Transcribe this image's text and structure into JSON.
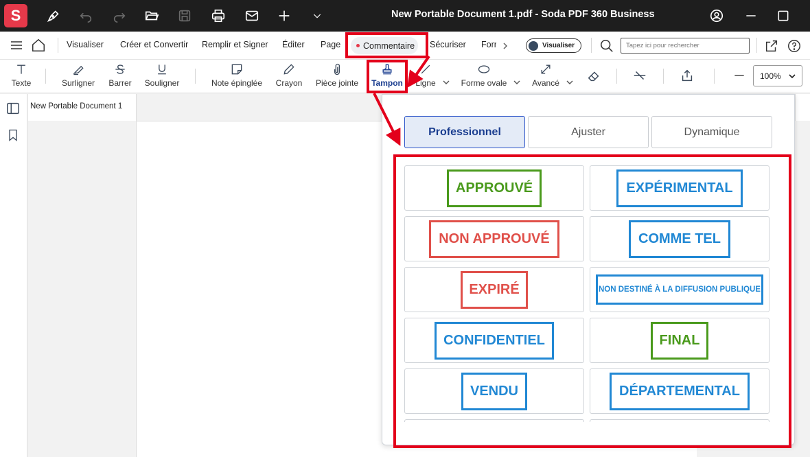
{
  "app": {
    "logo_letter": "S",
    "title": "New Portable Document 1.pdf  -  Soda PDF 360 Business"
  },
  "menu": {
    "items": [
      "Visualiser",
      "Créer et Convertir",
      "Remplir et Signer",
      "Éditer",
      "Page",
      "Commentaire",
      "Sécuriser",
      "Forr"
    ],
    "view_toggle_label": "Visualiser",
    "search_placeholder": "Tapez ici pour rechercher"
  },
  "toolbar": {
    "tools": {
      "texte": "Texte",
      "surligner": "Surligner",
      "barrer": "Barrer",
      "souligner": "Souligner",
      "note": "Note épinglée",
      "crayon": "Crayon",
      "piece": "Pièce jointe",
      "tampon": "Tampon",
      "ligne": "Ligne",
      "forme": "Forme ovale",
      "avance": "Avancé"
    },
    "zoom": "100%"
  },
  "document": {
    "tab_title": "New Portable Document 1"
  },
  "stamp_popup": {
    "tabs": [
      "Professionnel",
      "Ajuster",
      "Dynamique"
    ],
    "active_tab": "Professionnel",
    "stamps": [
      {
        "text": "APPROUVÉ",
        "color": "#4a9a1c"
      },
      {
        "text": "EXPÉRIMENTAL",
        "color": "#2188d4"
      },
      {
        "text": "NON APPROUVÉ",
        "color": "#e0504a"
      },
      {
        "text": "COMME TEL",
        "color": "#2188d4"
      },
      {
        "text": "EXPIRÉ",
        "color": "#e0504a"
      },
      {
        "text": "NON DESTINÉ À LA DIFFUSION PUBLIQUE",
        "color": "#2188d4"
      },
      {
        "text": "CONFIDENTIEL",
        "color": "#2188d4"
      },
      {
        "text": "FINAL",
        "color": "#4a9a1c"
      },
      {
        "text": "VENDU",
        "color": "#2188d4"
      },
      {
        "text": "DÉPARTEMENTAL",
        "color": "#2188d4"
      }
    ]
  },
  "colors": {
    "annotation": "#e3001b",
    "accent": "#1a3d8f",
    "titlebar": "#1e1e1e"
  }
}
